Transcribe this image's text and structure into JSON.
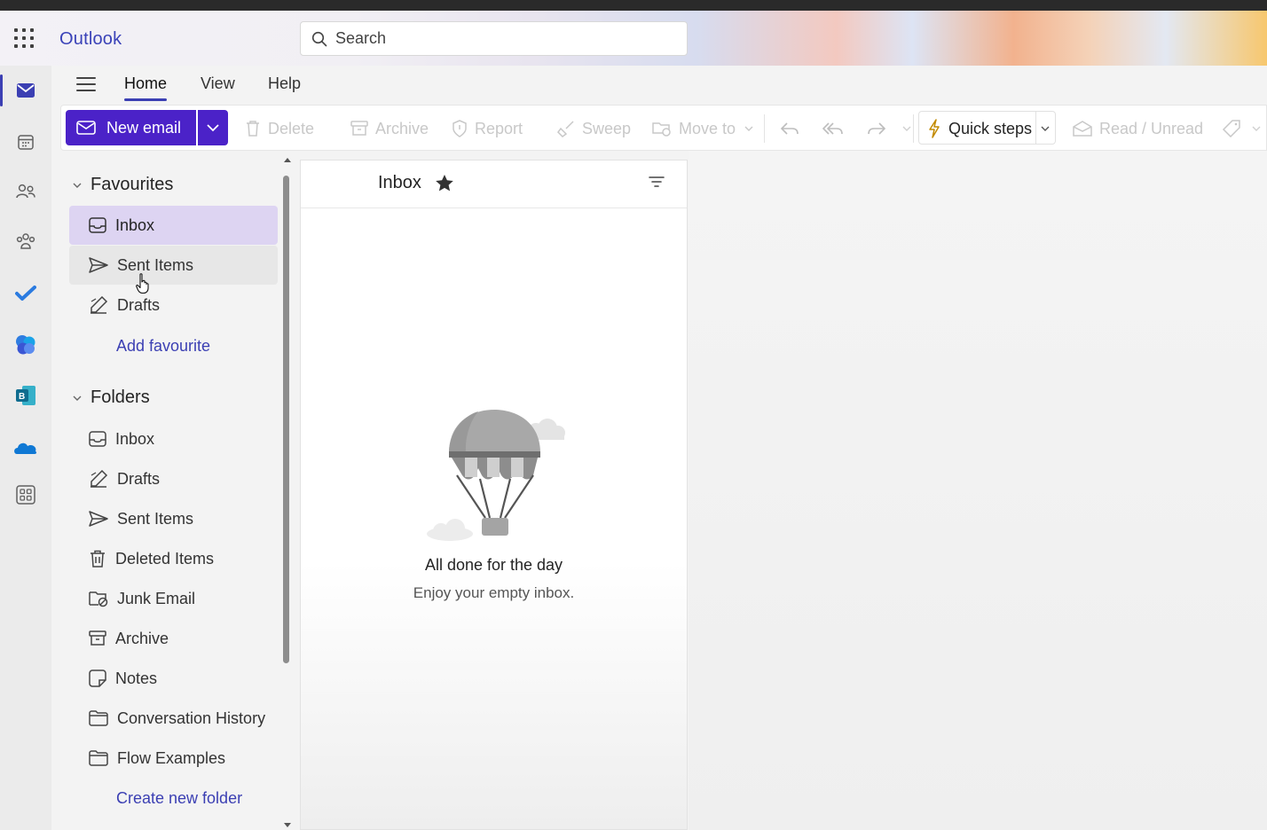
{
  "app": {
    "name": "Outlook"
  },
  "search": {
    "placeholder": "Search"
  },
  "ribbon": {
    "tabs": [
      {
        "label": "Home",
        "active": true
      },
      {
        "label": "View",
        "active": false
      },
      {
        "label": "Help",
        "active": false
      }
    ]
  },
  "toolbar": {
    "new_email": "New email",
    "delete": "Delete",
    "archive": "Archive",
    "report": "Report",
    "sweep": "Sweep",
    "move_to": "Move to",
    "quick_steps": "Quick steps",
    "read_unread": "Read / Unread"
  },
  "favourites": {
    "heading": "Favourites",
    "items": [
      {
        "label": "Inbox",
        "icon": "inbox-icon",
        "selected": true
      },
      {
        "label": "Sent Items",
        "icon": "send-icon",
        "selected": false
      },
      {
        "label": "Drafts",
        "icon": "drafts-icon",
        "selected": false
      }
    ],
    "add_link": "Add favourite"
  },
  "folders": {
    "heading": "Folders",
    "items": [
      {
        "label": "Inbox",
        "icon": "inbox-icon"
      },
      {
        "label": "Drafts",
        "icon": "drafts-icon"
      },
      {
        "label": "Sent Items",
        "icon": "send-icon"
      },
      {
        "label": "Deleted Items",
        "icon": "trash-icon"
      },
      {
        "label": "Junk Email",
        "icon": "junk-icon"
      },
      {
        "label": "Archive",
        "icon": "archive-icon"
      },
      {
        "label": "Notes",
        "icon": "note-icon"
      },
      {
        "label": "Conversation History",
        "icon": "folder-icon"
      },
      {
        "label": "Flow Examples",
        "icon": "folder-icon"
      }
    ],
    "create_link": "Create new folder"
  },
  "message_list": {
    "title": "Inbox",
    "empty_title": "All done for the day",
    "empty_subtitle": "Enjoy your empty inbox."
  },
  "colors": {
    "accent": "#4b22c8",
    "brand_text": "#3a42b8",
    "selected_bg": "#ddd4f2",
    "link": "#3b3fb3"
  }
}
